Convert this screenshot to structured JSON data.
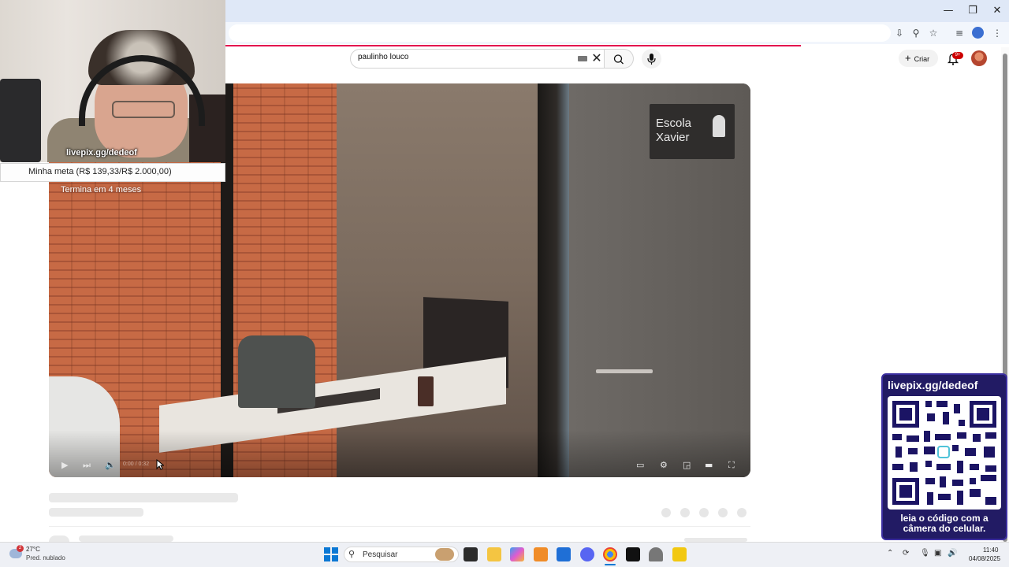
{
  "browser": {
    "window_controls": [
      "—",
      "❐",
      "✕"
    ],
    "toolbar_icons": [
      "install-icon",
      "zoom-icon",
      "star-icon",
      "media-icon",
      "profile-icon",
      "menu-icon"
    ]
  },
  "youtube": {
    "search": {
      "value": "paulinho louco"
    },
    "create_label": "Criar",
    "notification_badge": "9+"
  },
  "video": {
    "sign_line1": "Escola",
    "sign_line2": "Xavier",
    "time": "0:00 / 0:32"
  },
  "webcam": {
    "url": "livepix.gg/dedeof",
    "goal": "Minha meta (R$ 139,33/R$ 2.000,00)",
    "goal_sub": "Termina em 4 meses"
  },
  "qr_overlay": {
    "url": "livepix.gg/dedeof",
    "caption": "leia o código com a câmera do celular."
  },
  "taskbar": {
    "weather_temp": "27°C",
    "weather_desc": "Pred. nublado",
    "weather_badge": "2",
    "search_placeholder": "Pesquisar",
    "time": "11:40",
    "date": "04/08/2025"
  }
}
